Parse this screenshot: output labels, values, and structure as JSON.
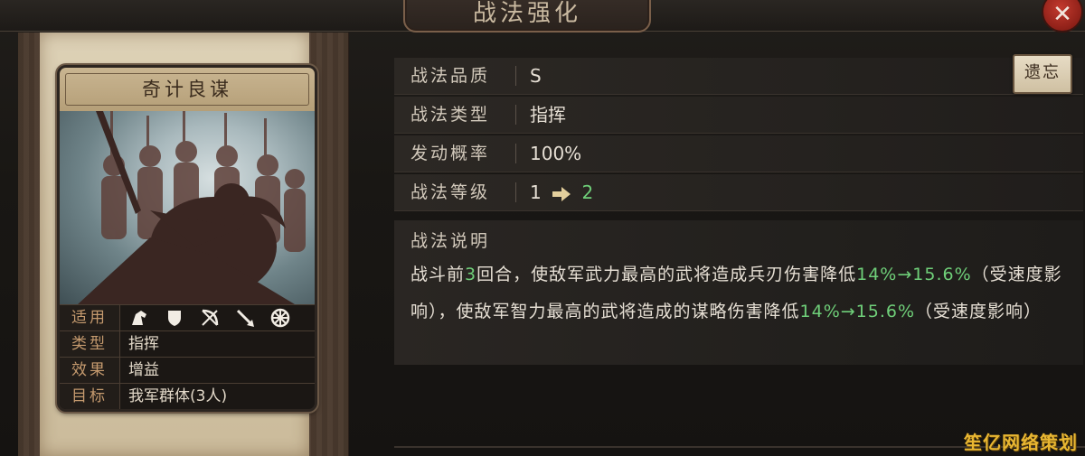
{
  "header": {
    "title": "战法强化",
    "close_symbol": "✕"
  },
  "card": {
    "name": "奇计良谋",
    "rows": [
      {
        "label": "适用",
        "icons": [
          "cavalry-icon",
          "shield-icon",
          "archer-icon",
          "spear-icon",
          "wheel-icon"
        ]
      },
      {
        "label": "类型",
        "value": "指挥"
      },
      {
        "label": "效果",
        "value": "增益"
      },
      {
        "label": "目标",
        "value": "我军群体(3人)"
      }
    ]
  },
  "attributes": [
    {
      "label": "战法品质",
      "value": "S"
    },
    {
      "label": "战法类型",
      "value": "指挥"
    },
    {
      "label": "发动概率",
      "value": "100%"
    },
    {
      "label": "战法等级",
      "value_from": "1",
      "value_to": "2"
    }
  ],
  "replace_button": "遗忘",
  "description": {
    "title": "战法说明",
    "segments": [
      {
        "text": "战斗前",
        "green": false
      },
      {
        "text": "3",
        "green": true
      },
      {
        "text": "回合，使敌军武力最高的武将造成兵刃伤害降低",
        "green": false
      },
      {
        "text": "14%→15.6%",
        "green": true
      },
      {
        "text": "（受速度影响），使敌军智力最高的武将造成的谋略伤害降低",
        "green": false
      },
      {
        "text": "14%→15.6%",
        "green": true
      },
      {
        "text": "（受速度影响）",
        "green": false
      }
    ]
  },
  "watermark": "笙亿网络策划",
  "colors": {
    "highlight_green": "#6fcf79",
    "label_orange": "#c59a6e",
    "close_red": "#c33a2e"
  }
}
